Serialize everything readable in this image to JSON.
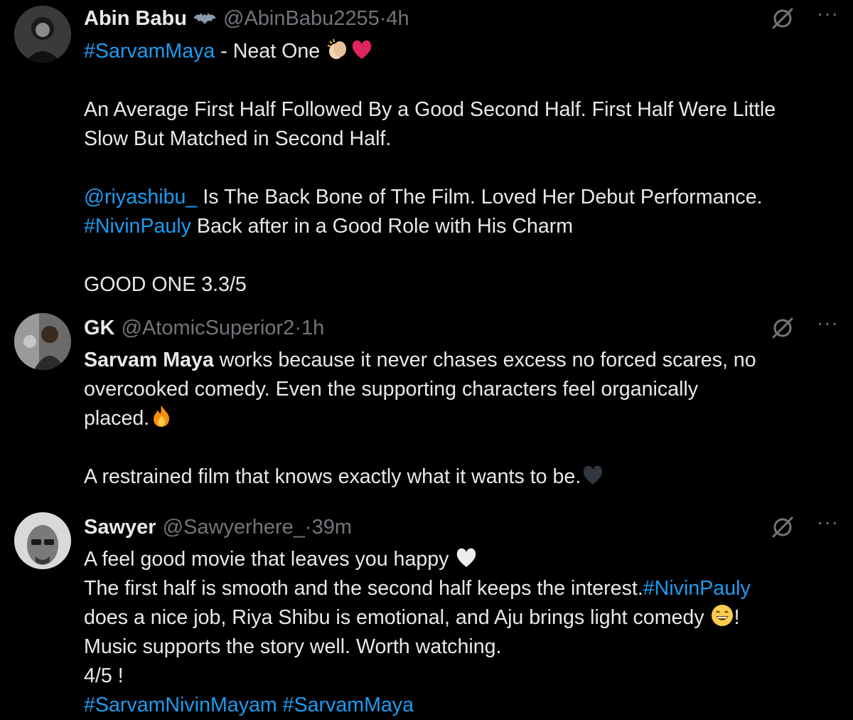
{
  "tweets": [
    {
      "name": "Abin Babu",
      "handle": "@AbinBabu2255",
      "time": "4h",
      "lines": {
        "l1_tag": "#SarvamMaya",
        "l1_text": " - Neat One ",
        "l2": "An Average First Half Followed By a Good Second Half. First Half Were Little",
        "l3": "Slow But Matched in Second Half.",
        "l4_mention": "@riyashibu_",
        "l4_text": " Is The Back Bone of The Film. Loved Her Debut Performance.",
        "l5_tag": "#NivinPauly",
        "l5_text": " Back after in a Good Role with His Charm",
        "l6": "GOOD ONE 3.3/5"
      }
    },
    {
      "name": "GK",
      "handle": "@AtomicSuperior2",
      "time": "1h",
      "lines": {
        "l1_bold": "Sarvam Maya",
        "l1_text": " works because it never chases excess no forced scares, no",
        "l2": "overcooked comedy. Even the supporting characters feel organically",
        "l3": "placed.",
        "l4": "A restrained film that knows exactly what it wants to be."
      }
    },
    {
      "name": "Sawyer",
      "handle": "@Sawyerhere_",
      "time": "39m",
      "lines": {
        "l1": "A feel good movie that leaves you happy ",
        "l2_text": "The first half is smooth and the second half keeps the interest.",
        "l2_tag": "#NivinPauly",
        "l3": "does a nice job, Riya Shibu is emotional, and Aju brings light comedy ",
        "l3_end": "!",
        "l4": "Music supports the story well. Worth watching.",
        "l5": "4/5 !",
        "l6_tag1": "#SarvamNivinMayam",
        "l6_tag2": "#SarvamMaya"
      }
    }
  ],
  "separator": " · ",
  "more_label": "···",
  "colors": {
    "background": "#000000",
    "text": "#e7e9ea",
    "muted": "#71767b",
    "link": "#1d9bf0"
  },
  "icons": [
    "grok-icon",
    "more-icon",
    "avatar",
    "batman-badge-icon",
    "clapping-hands-emoji",
    "red-heart-emoji",
    "fire-emoji",
    "black-heart-emoji",
    "white-heart-emoji",
    "grinning-face-emoji"
  ]
}
